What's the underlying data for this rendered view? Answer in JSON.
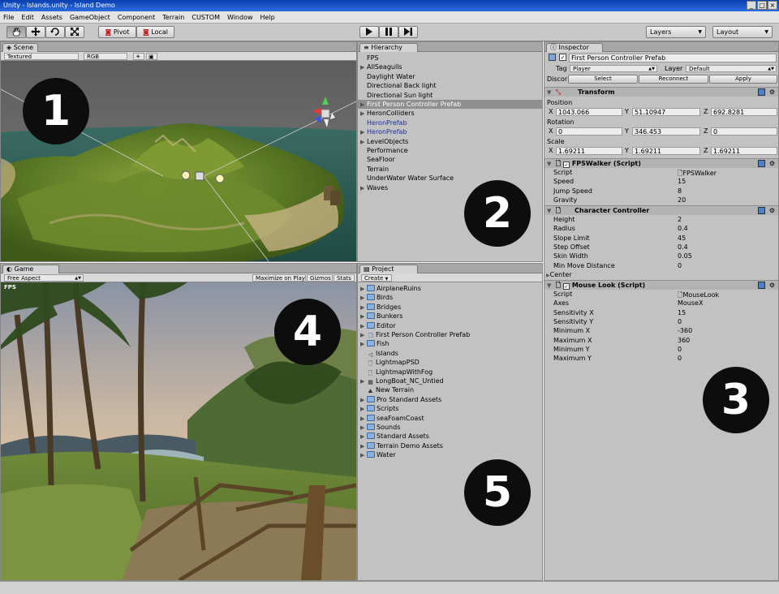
{
  "window": {
    "title": "Unity - Islands.unity - Island Demo"
  },
  "menu": [
    "File",
    "Edit",
    "Assets",
    "GameObject",
    "Component",
    "Terrain",
    "CUSTOM",
    "Window",
    "Help"
  ],
  "toolbar": {
    "pivot": "Pivot",
    "local": "Local",
    "layers": "Layers",
    "layout": "Layout"
  },
  "scene": {
    "tab": "Scene",
    "render_mode": "Textured",
    "color_mode": "RGB"
  },
  "game": {
    "tab": "Game",
    "aspect": "Free Aspect",
    "maximize": "Maximize on Play",
    "gizmos": "Gizmos",
    "stats": "Stats",
    "fps": "FPS"
  },
  "hierarchy": {
    "tab": "Hierarchy",
    "items": [
      {
        "label": "FPS",
        "arrow": "",
        "style": ""
      },
      {
        "label": "AllSeagulls",
        "arrow": "▶",
        "style": ""
      },
      {
        "label": "Daylight Water",
        "arrow": "",
        "style": ""
      },
      {
        "label": "Directional Back light",
        "arrow": "",
        "style": ""
      },
      {
        "label": "Directional Sun light",
        "arrow": "",
        "style": ""
      },
      {
        "label": "First Person Controller Prefab",
        "arrow": "▶",
        "style": "sel"
      },
      {
        "label": "HeronColliders",
        "arrow": "▶",
        "style": ""
      },
      {
        "label": "HeronPrefab",
        "arrow": "",
        "style": "blue"
      },
      {
        "label": "HeronPrefab",
        "arrow": "▶",
        "style": "blue"
      },
      {
        "label": "LevelObjects",
        "arrow": "▶",
        "style": ""
      },
      {
        "label": "Performance",
        "arrow": "",
        "style": ""
      },
      {
        "label": "SeaFloor",
        "arrow": "",
        "style": ""
      },
      {
        "label": "Terrain",
        "arrow": "",
        "style": ""
      },
      {
        "label": "UnderWater Water Surface",
        "arrow": "",
        "style": ""
      },
      {
        "label": "Waves",
        "arrow": "▶",
        "style": ""
      }
    ]
  },
  "project": {
    "tab": "Project",
    "create": "Create",
    "items": [
      {
        "label": "AirplaneRuins",
        "arrow": "▶",
        "icon": "folder"
      },
      {
        "label": "Birds",
        "arrow": "▶",
        "icon": "folder"
      },
      {
        "label": "Bridges",
        "arrow": "▶",
        "icon": "folder"
      },
      {
        "label": "Bunkers",
        "arrow": "▶",
        "icon": "folder"
      },
      {
        "label": "Editor",
        "arrow": "▶",
        "icon": "folder"
      },
      {
        "label": "First Person Controller Prefab",
        "arrow": "▶",
        "icon": "prefab"
      },
      {
        "label": "Fish",
        "arrow": "▶",
        "icon": "folder"
      },
      {
        "label": "Islands",
        "arrow": "",
        "icon": "unity"
      },
      {
        "label": "LightmapPSD",
        "arrow": "",
        "icon": "file"
      },
      {
        "label": "LightmapWithFog",
        "arrow": "",
        "icon": "file"
      },
      {
        "label": "LongBoat_NC_Untied",
        "arrow": "▶",
        "icon": "model"
      },
      {
        "label": "New Terrain",
        "arrow": "",
        "icon": "terrain"
      },
      {
        "label": "Pro Standard Assets",
        "arrow": "▶",
        "icon": "folder"
      },
      {
        "label": "Scripts",
        "arrow": "▶",
        "icon": "folder"
      },
      {
        "label": "seaFoamCoast",
        "arrow": "▶",
        "icon": "folder"
      },
      {
        "label": "Sounds",
        "arrow": "▶",
        "icon": "folder"
      },
      {
        "label": "Standard Assets",
        "arrow": "▶",
        "icon": "folder"
      },
      {
        "label": "Terrain Demo Assets",
        "arrow": "▶",
        "icon": "folder"
      },
      {
        "label": "Water",
        "arrow": "▶",
        "icon": "folder"
      }
    ]
  },
  "inspector": {
    "tab": "Inspector",
    "object_name": "First Person Controller Prefab",
    "tag_label": "Tag",
    "tag_value": "Player",
    "layer_label": "Layer",
    "layer_value": "Default",
    "prefab_label": "Discor",
    "select": "Select",
    "reconnect": "Reconnect",
    "apply": "Apply",
    "transform": {
      "title": "Transform",
      "position_label": "Position",
      "rotation_label": "Rotation",
      "scale_label": "Scale",
      "position": [
        "1043.066",
        "51.10947",
        "692.8281"
      ],
      "rotation": [
        "0",
        "346.453",
        "0"
      ],
      "scale": [
        "1.69211",
        "1.69211",
        "1.69211"
      ]
    },
    "fpswalker": {
      "title": "FPSWalker (Script)",
      "props": [
        {
          "name": "Script",
          "value": "FPSWalker"
        },
        {
          "name": "Speed",
          "value": "15"
        },
        {
          "name": "Jump Speed",
          "value": "8"
        },
        {
          "name": "Gravity",
          "value": "20"
        }
      ]
    },
    "character_controller": {
      "title": "Character Controller",
      "props": [
        {
          "name": "Height",
          "value": "2"
        },
        {
          "name": "Radius",
          "value": "0.4"
        },
        {
          "name": "Slope Limit",
          "value": "45"
        },
        {
          "name": "Step Offset",
          "value": "0.4"
        },
        {
          "name": "Skin Width",
          "value": "0.05"
        },
        {
          "name": "Min Move Distance",
          "value": "0"
        }
      ],
      "center": "Center"
    },
    "mouselook": {
      "title": "Mouse Look (Script)",
      "props": [
        {
          "name": "Script",
          "value": "MouseLook"
        },
        {
          "name": "Axes",
          "value": "MouseX"
        },
        {
          "name": "Sensitivity X",
          "value": "15"
        },
        {
          "name": "Sensitivity Y",
          "value": "0"
        },
        {
          "name": "Minimum X",
          "value": "-360"
        },
        {
          "name": "Maximum X",
          "value": "360"
        },
        {
          "name": "Minimum Y",
          "value": "0"
        },
        {
          "name": "Maximum Y",
          "value": "0"
        }
      ]
    }
  },
  "callouts": [
    "1",
    "2",
    "3",
    "4",
    "5"
  ]
}
